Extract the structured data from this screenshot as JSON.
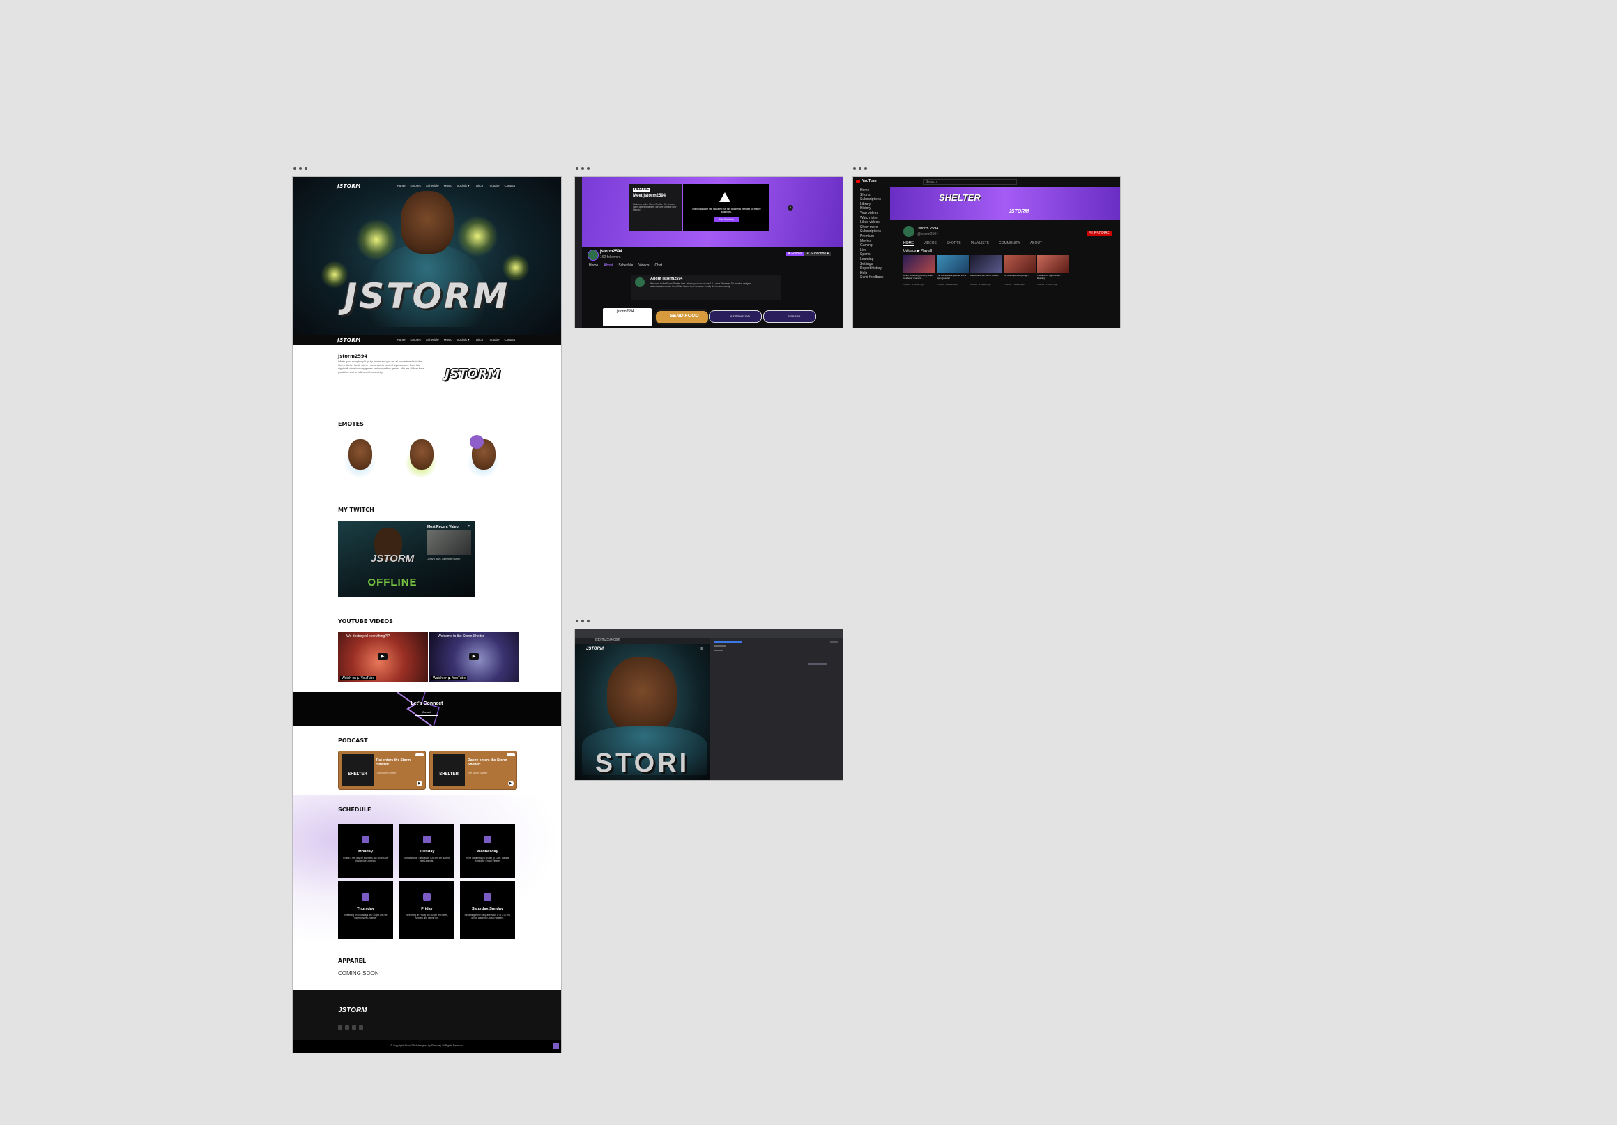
{
  "site": {
    "logo": "JSTORM",
    "nav": [
      "Home",
      "Emotes",
      "Schedule",
      "Music",
      "Socials ▾",
      "Twitch",
      "Youtube",
      "Contact"
    ],
    "hero_title": "JSTORM",
    "about": {
      "title": "Jstorm2594",
      "body": "Whats good everybody! I go by Jstorm and you are all now entered in to the Storm Shelter family where I run a variety content style streams. From late night chill vibes to scary games and competitive grinds... We are all here for a good time and to build a chill community!",
      "logo": "JSTORM"
    },
    "emotes_title": "EMOTES",
    "twitch_title": "MY TWITCH",
    "twitch_embed": {
      "recent_label": "Most Recent Video",
      "video_caption": "Jordy's guys, gameplay dumb!?",
      "offline": "OFFLINE",
      "logo": "JSTORM"
    },
    "youtube_title": "YOUTUBE VIDEOS",
    "youtube_videos": [
      {
        "title": "We destroyed everything?!?",
        "watch": "Watch on ▶ YouTube"
      },
      {
        "title": "Welcome to the Storm Shelter",
        "watch": "Watch on ▶ YouTube"
      }
    ],
    "connect": {
      "title": "Let's Connect",
      "button": "Contact"
    },
    "podcast_title": "PODCAST",
    "podcasts": [
      {
        "title": "Pat enters the Storm Shelter!",
        "sub": "The Storm Shelter",
        "art": "SHELTER"
      },
      {
        "title": "Danny enters the Storm Shelter!",
        "sub": "The Storm Shelter",
        "art": "SHELTER"
      }
    ],
    "schedule_title": "SCHEDULE",
    "schedule": [
      {
        "day": "Monday",
        "text": "I'll take a rest day on Mondays as 7:30 pm, we playing ripe Legends."
      },
      {
        "day": "Tuesday",
        "text": "Streaming on Tuesday at 7:30 pm, we playing ripe Legends."
      },
      {
        "day": "Wednesday",
        "text": "I'll be Wednesday 7:30 pm to 11pm, playing Hunted for Crowd Pleaser!"
      },
      {
        "day": "Thursday",
        "text": "Streaming on Thursdays at 7:30 pm and we playing Apex Legends."
      },
      {
        "day": "Friday",
        "text": "Streaming on Friday at 7:30 pm chill vibes, hanging and having fun."
      },
      {
        "day": "Saturday/Sunday",
        "text": "Streaming in the early afternoon or at 7:30 pm, will be watching Crowd Pleasers."
      }
    ],
    "apparel_title": "APPAREL",
    "apparel_text": "COMING SOON",
    "footer_logo": "JSTORM",
    "footer_copy": "© Copyright Jstorm2594 designed by Shelolia | All Rights Reserved"
  },
  "twitch": {
    "channel": "jstorm2594",
    "followers": "162 followers",
    "panel_badge": "OFFLINE",
    "panel_title": "Meet jstorm2594",
    "panel_text": "Welcome to the Storm Shelter. We stream many different genres, we love to make new friends!",
    "popup_text": "This broadcaster has indicated that this channel is intended for mature audiences.",
    "popup_button": "Start Watching",
    "follow_button": "♥ Follow",
    "subscribe_button": "★ Subscribe ▾",
    "tabs": [
      "Home",
      "About",
      "Schedule",
      "Videos",
      "Chat"
    ],
    "about_title": "About jstorm2594",
    "about_text": "Welcome to the Storm Shelter. I am Jstorm, you can call me J.J. I am a Streamer, 3D creative designer and character creator from Ohio. I came here because I really like the community!",
    "panels": [
      "jstorm2594",
      "SEND FOOD",
      "INFORMATION",
      "DISCORD"
    ]
  },
  "youtube": {
    "brand": "YouTube",
    "search": "Search",
    "banner_title": "SHELTER",
    "banner_logo": "JSTORM",
    "channel": "Jstorm 2594",
    "handle": "@jstorm2594",
    "subscribe": "SUBSCRIBE",
    "tabs": [
      "HOME",
      "VIDEOS",
      "SHORTS",
      "PLAYLISTS",
      "COMMUNITY",
      "ABOUT"
    ],
    "section": "Uploads ▶ Play all",
    "sidebar": [
      "Home",
      "Shorts",
      "Subscriptions",
      "Library",
      "History",
      "Your videos",
      "Watch later",
      "Liked videos",
      "Show more",
      "Subscriptions",
      "Premium",
      "Movies",
      "Gaming",
      "Live",
      "Sports",
      "Learning",
      "Settings",
      "Report history",
      "Help",
      "Send feedback"
    ],
    "videos": [
      {
        "title": "When something perfectly leads to a better moment...",
        "meta": "4 views · 2 weeks ago"
      },
      {
        "title": "The unbreakable gauntlet in the Apex gauntlet!",
        "meta": "5 views · 2 weeks ago"
      },
      {
        "title": "Welcome to the Storm Shelter!",
        "meta": "8 views · 3 weeks ago"
      },
      {
        "title": "We destroyed everything?!?",
        "meta": "6 views · 3 weeks ago"
      },
      {
        "title": "I Mauled my opponents!!! #gaming",
        "meta": "4 views · 1 month ago"
      }
    ]
  },
  "browser": {
    "url": "jstorm2594.com",
    "devtools_url": "jstorm2594.com",
    "logo": "JSTORM",
    "hero_text": "STORI"
  },
  "colors": {
    "background": "#e3e3e3",
    "twitch_purple": "#9147ff",
    "podcast_brown": "#b07438",
    "schedule_icon": "#7b5bc4",
    "youtube_red": "#cc0000"
  }
}
